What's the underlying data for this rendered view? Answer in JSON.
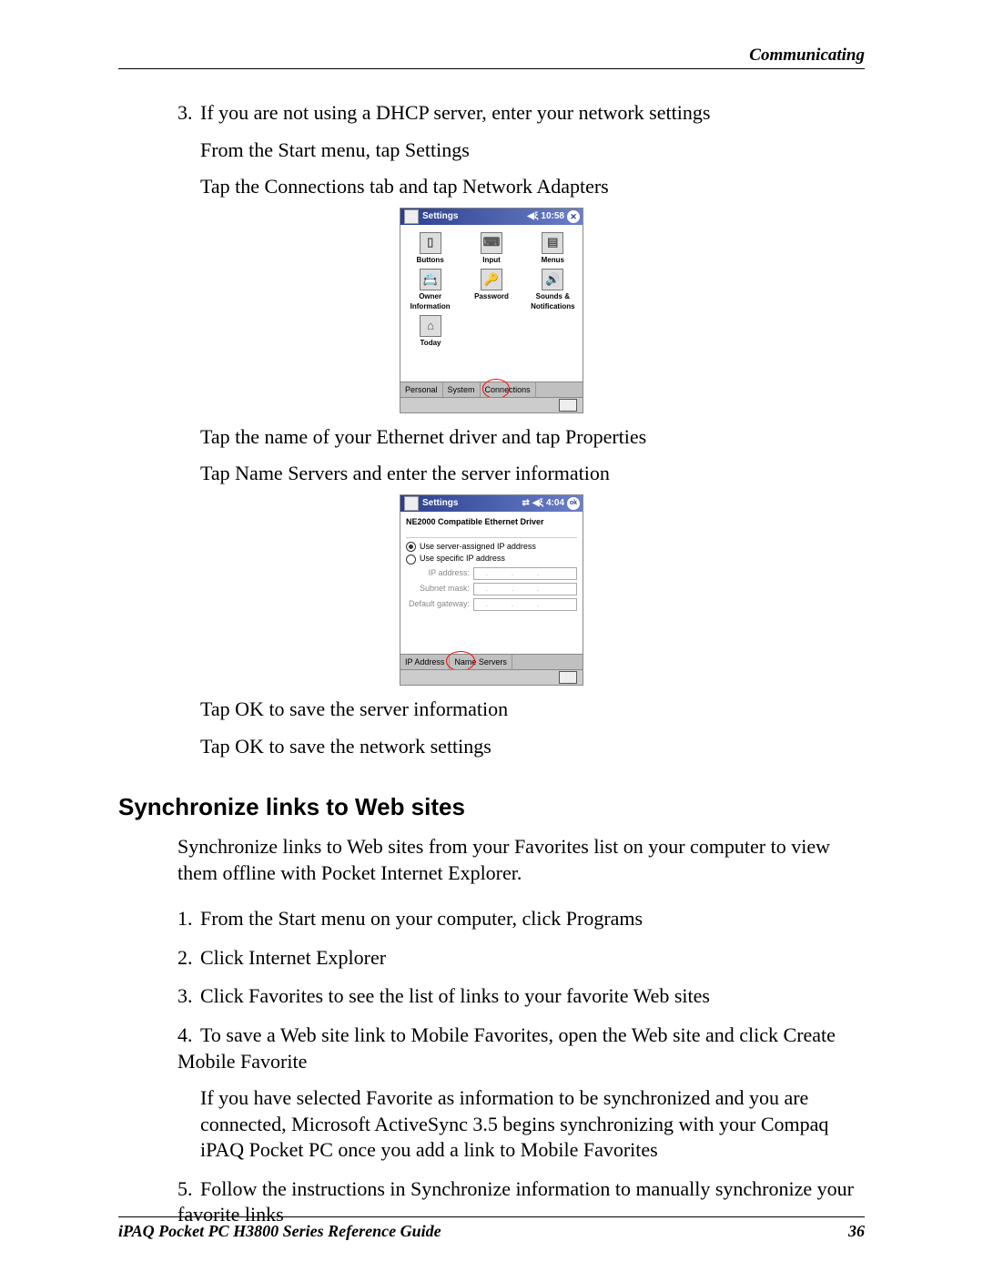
{
  "header": {
    "section_title": "Communicating"
  },
  "step3": {
    "number": "3.",
    "text": "If you are not using a DHCP server, enter your network settings",
    "sub1": "From the Start menu, tap Settings",
    "sub2": "Tap the Connections tab and tap Network Adapters",
    "sub3": "Tap the name of your Ethernet driver and tap Properties",
    "sub4": "Tap Name Servers and enter the server information",
    "sub5": "Tap OK to save the server information",
    "sub6": "Tap OK to save the network settings"
  },
  "ppc1": {
    "title": "Settings",
    "time": "10:58",
    "close_glyph": "✕",
    "icons_row1": [
      {
        "label": "Buttons",
        "glyph": "▯"
      },
      {
        "label": "Input",
        "glyph": "⌨"
      },
      {
        "label": "Menus",
        "glyph": "▤"
      }
    ],
    "icons_row2": [
      {
        "label": "Owner Information",
        "glyph": "📇"
      },
      {
        "label": "Password",
        "glyph": "🔑"
      },
      {
        "label": "Sounds & Notifications",
        "glyph": "🔊"
      }
    ],
    "icons_row3": [
      {
        "label": "Today",
        "glyph": "⌂"
      }
    ],
    "tabs": [
      "Personal",
      "System",
      "Connections"
    ]
  },
  "ppc2": {
    "title": "Settings",
    "time": "4:04",
    "ok_glyph": "ok",
    "heading": "NE2000 Compatible Ethernet Driver",
    "radio1": "Use server-assigned IP address",
    "radio2": "Use specific IP address",
    "fields": {
      "ip": "IP address:",
      "subnet": "Subnet mask:",
      "gateway": "Default gateway:"
    },
    "tabs": [
      "IP Address",
      "Name Servers"
    ]
  },
  "section2": {
    "heading": "Synchronize links to Web sites",
    "intro": "Synchronize links to Web sites from your Favorites list on your computer to view them offline with Pocket Internet Explorer.",
    "steps": [
      {
        "n": "1.",
        "t": "From the Start menu on your computer, click Programs"
      },
      {
        "n": "2.",
        "t": "Click Internet Explorer"
      },
      {
        "n": "3.",
        "t": "Click Favorites to see the list of links to your favorite Web sites"
      },
      {
        "n": "4.",
        "t": "To save a Web site link to Mobile Favorites, open the Web site and click Create Mobile Favorite",
        "extra": "If you have selected Favorite as information to be synchronized and you are connected, Microsoft ActiveSync 3.5 begins synchronizing with your Compaq iPAQ Pocket PC once you add a link to Mobile Favorites"
      },
      {
        "n": "5.",
        "t": "Follow the instructions in Synchronize information to manually synchronize your favorite links"
      }
    ]
  },
  "footer": {
    "left": "iPAQ Pocket PC H3800 Series Reference Guide",
    "right": "36"
  },
  "dot": "."
}
